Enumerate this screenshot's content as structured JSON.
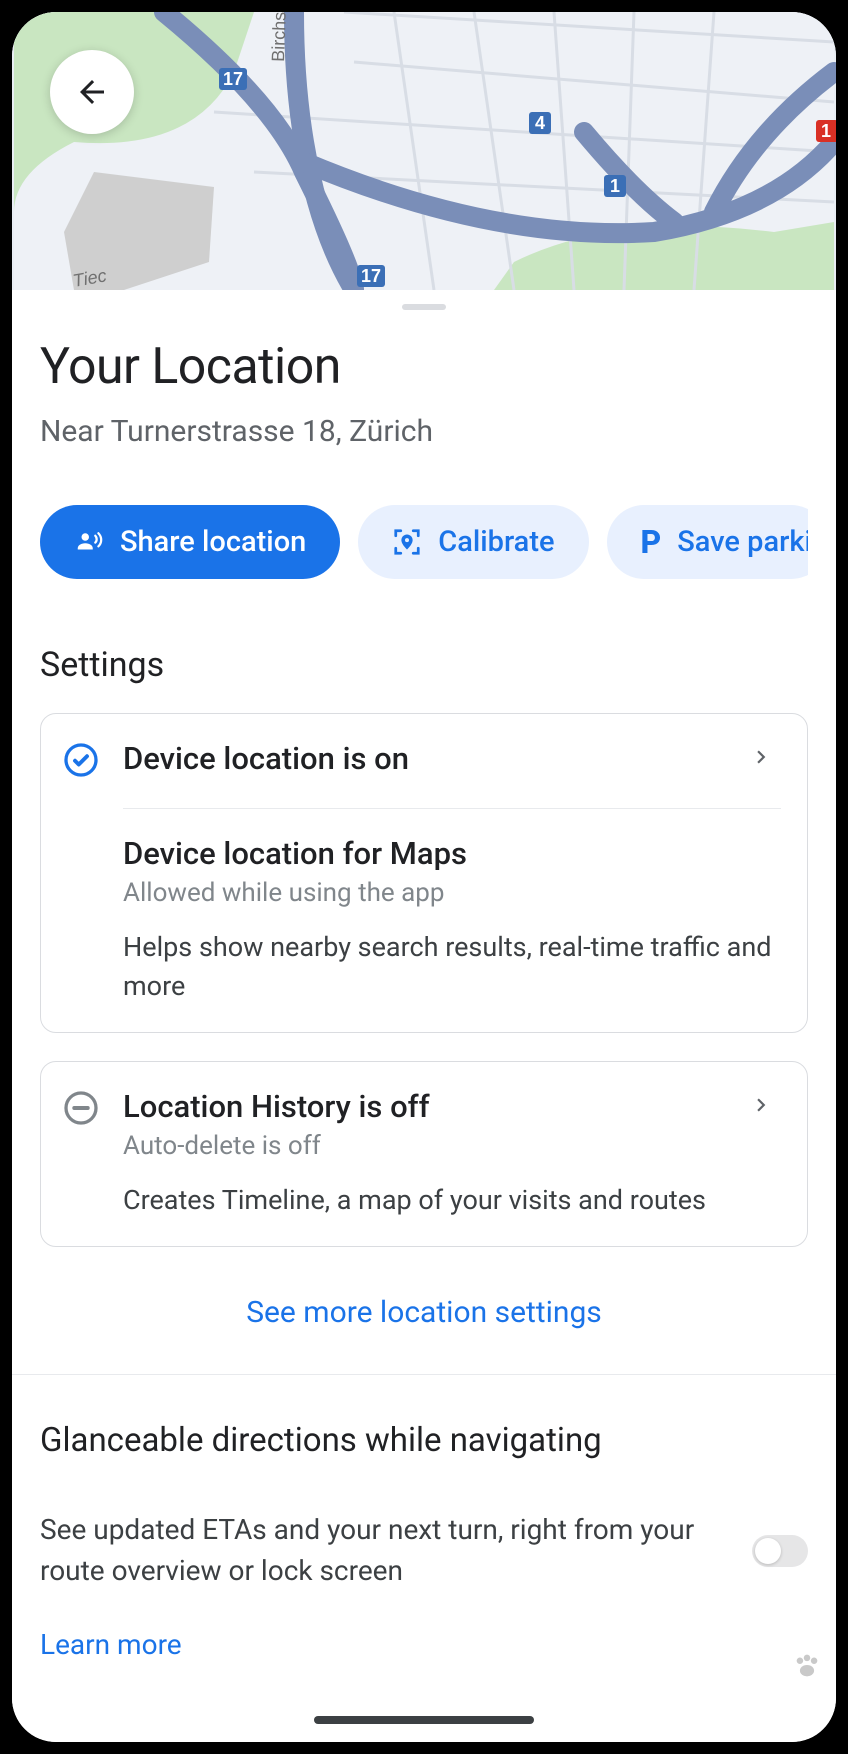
{
  "header": {
    "title": "Your Location",
    "subtitle": "Near Turnerstrasse 18, Zürich"
  },
  "chips": {
    "share": "Share location",
    "calibrate": "Calibrate",
    "save_parking": "Save parkin"
  },
  "settings": {
    "header": "Settings",
    "device_location": {
      "title": "Device location is on",
      "maps_title": "Device location for Maps",
      "maps_sub": "Allowed while using the app",
      "maps_desc": "Helps show nearby search results, real-time traffic and more"
    },
    "location_history": {
      "title": "Location History is off",
      "sub": "Auto-delete is off",
      "desc": "Creates Timeline, a map of your visits and routes"
    },
    "see_more": "See more location settings"
  },
  "glance": {
    "title": "Glanceable directions while navigating",
    "desc": "See updated ETAs and your next turn, right from your route overview or lock screen",
    "learn_more": "Learn more"
  },
  "map": {
    "street_label": "Birchstra",
    "street_label_2": "Tiec",
    "shields": [
      "17",
      "4",
      "1",
      "17",
      "1"
    ]
  }
}
